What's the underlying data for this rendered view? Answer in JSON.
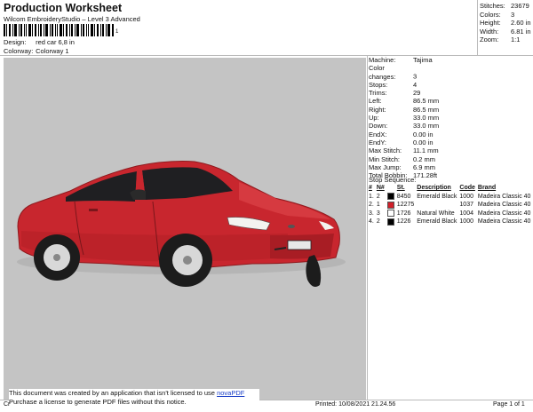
{
  "header": {
    "title": "Production Worksheet",
    "software": "Wilcom EmbroideryStudio – Level 3 Advanced",
    "barcode_number": "1"
  },
  "meta": [
    {
      "key": "Design:",
      "value": "red car 6,8 in"
    },
    {
      "key": "Colorway:",
      "value": "Colorway 1"
    }
  ],
  "summary": [
    {
      "key": "Stitches:",
      "value": "23679"
    },
    {
      "key": "Colors:",
      "value": "3"
    },
    {
      "key": "Height:",
      "value": "2.60 in"
    },
    {
      "key": "Width:",
      "value": "6.81 in"
    },
    {
      "key": "Zoom:",
      "value": "1:1"
    }
  ],
  "properties": [
    {
      "key": "Machine:",
      "value": "Tajima"
    },
    {
      "key": "Color changes:",
      "value": "3"
    },
    {
      "key": "Stops:",
      "value": "4"
    },
    {
      "key": "Trims:",
      "value": "29"
    },
    {
      "key": "Left:",
      "value": "86.5 mm"
    },
    {
      "key": "Right:",
      "value": "86.5 mm"
    },
    {
      "key": "Up:",
      "value": "33.0 mm"
    },
    {
      "key": "Down:",
      "value": "33.0 mm"
    },
    {
      "key": "EndX:",
      "value": "0.00 in"
    },
    {
      "key": "EndY:",
      "value": "0.00 in"
    },
    {
      "key": "Max Stitch:",
      "value": "11.1 mm"
    },
    {
      "key": "Min Stitch:",
      "value": "0.2 mm"
    },
    {
      "key": "Max Jump:",
      "value": "6.9 mm"
    },
    {
      "key": "Total Bobbin:",
      "value": "171.28ft"
    }
  ],
  "stop_sequence": {
    "title": "Stop Sequence:",
    "headers": [
      "#",
      "N#",
      "",
      "St.",
      "Description",
      "Code",
      "Brand"
    ],
    "rows": [
      {
        "num": "1.",
        "n": "2",
        "color": "#000000",
        "stitches": "8450",
        "description": "Emerald Black",
        "code": "1000",
        "brand": "Madeira Classic 40"
      },
      {
        "num": "2.",
        "n": "1",
        "color": "#d0202a",
        "stitches": "12275",
        "description": "",
        "code": "1037",
        "brand": "Madeira Classic 40"
      },
      {
        "num": "3.",
        "n": "3",
        "color": "#ffffff",
        "stitches": "1726",
        "description": "Natural White",
        "code": "1004",
        "brand": "Madeira Classic 40"
      },
      {
        "num": "4.",
        "n": "2",
        "color": "#000000",
        "stitches": "1226",
        "description": "Emerald Black",
        "code": "1000",
        "brand": "Madeira Classic 40"
      }
    ]
  },
  "notice": {
    "line1": "This document was created by an application that isn't licensed to use",
    "link": "novaPDF",
    "line2": "Purchase a license to generate PDF files without this notice."
  },
  "footer": {
    "left": "Cr",
    "printed": "Printed: 10/08/2021 21.24.56",
    "page": "Page 1 of 1"
  },
  "colors": {
    "canvas_background": "#c4c4c4",
    "car_body": "#c8262e",
    "link": "#1a3fc7"
  }
}
